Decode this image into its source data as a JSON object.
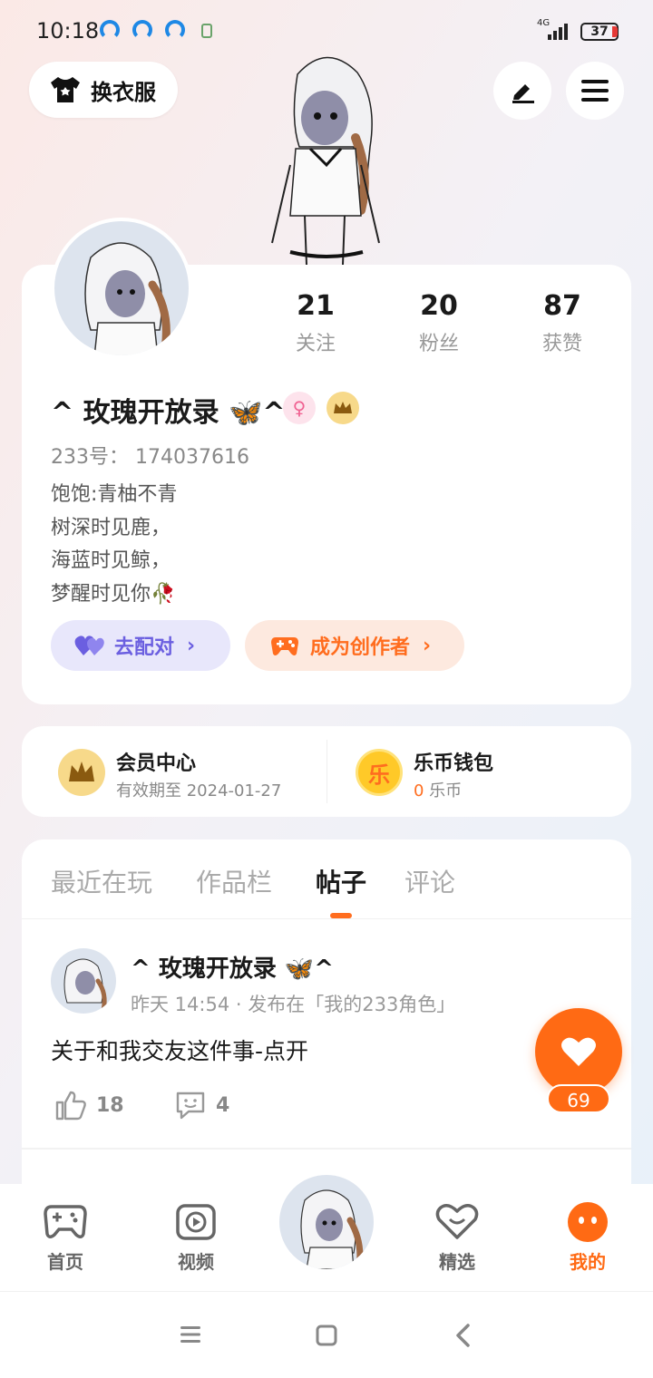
{
  "status_bar": {
    "time": "10:18",
    "network": "4G",
    "battery": "37"
  },
  "header": {
    "dress_label": "换衣服"
  },
  "profile": {
    "stats": [
      {
        "value": "21",
        "label": "关注"
      },
      {
        "value": "20",
        "label": "粉丝"
      },
      {
        "value": "87",
        "label": "获赞"
      }
    ],
    "name": "^ 玫瑰开放录 🦋^",
    "gender_symbol": "♀",
    "uid": "233号：  174037616",
    "bio": [
      "饱饱:青柚不青",
      "树深时见鹿，",
      "海蓝时见鲸，",
      "梦醒时见你🥀"
    ],
    "match_label": "去配对",
    "creator_label": "成为创作者"
  },
  "member": {
    "title": "会员中心",
    "subtitle": "有效期至 2024-01-27"
  },
  "wallet": {
    "title": "乐币钱包",
    "amount": "0",
    "unit": " 乐币",
    "icon_char": "乐"
  },
  "tabs": [
    "最近在玩",
    "作品栏",
    "帖子",
    "评论"
  ],
  "post": {
    "author": "^ 玫瑰开放录 🦋^",
    "meta": "昨天 14:54 · 发布在「我的233角色」",
    "title": "关于和我交友这件事-点开",
    "likes": "18",
    "comments": "4"
  },
  "floating_like": {
    "count": "69"
  },
  "nav": [
    {
      "label": "首页"
    },
    {
      "label": "视频"
    },
    {
      "label": "精选"
    },
    {
      "label": "我的"
    }
  ],
  "colors": {
    "accent": "#ff6a14",
    "match": "#6b5fe0",
    "vip_gold": "#f7d98a"
  }
}
